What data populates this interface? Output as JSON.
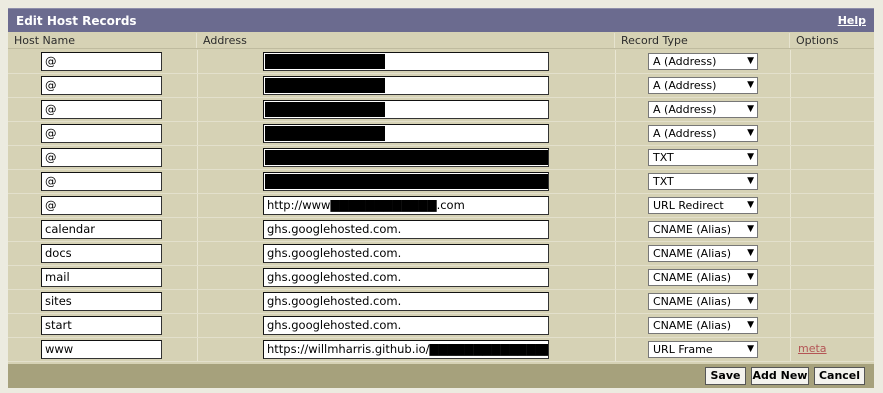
{
  "title": "Edit Host Records",
  "help_label": "Help",
  "columns": [
    "Host Name",
    "Address",
    "Record Type",
    "Options"
  ],
  "records": [
    {
      "host": "@",
      "addr": "",
      "redact": 120,
      "type": "A (Address)",
      "option": ""
    },
    {
      "host": "@",
      "addr": "",
      "redact": 120,
      "type": "A (Address)",
      "option": ""
    },
    {
      "host": "@",
      "addr": "",
      "redact": 120,
      "type": "A (Address)",
      "option": ""
    },
    {
      "host": "@",
      "addr": "",
      "redact": 120,
      "type": "A (Address)",
      "option": ""
    },
    {
      "host": "@",
      "addr": "",
      "redact": 284,
      "type": "TXT",
      "option": ""
    },
    {
      "host": "@",
      "addr": "",
      "redact": 284,
      "type": "TXT",
      "option": ""
    },
    {
      "host": "@",
      "addr": "http://www▇▇▇▇▇▇▇▇▇▇▇▇.com",
      "redact": 0,
      "type": "URL Redirect",
      "option": ""
    },
    {
      "host": "calendar",
      "addr": "ghs.googlehosted.com.",
      "redact": 0,
      "type": "CNAME (Alias)",
      "option": ""
    },
    {
      "host": "docs",
      "addr": "ghs.googlehosted.com.",
      "redact": 0,
      "type": "CNAME (Alias)",
      "option": ""
    },
    {
      "host": "mail",
      "addr": "ghs.googlehosted.com.",
      "redact": 0,
      "type": "CNAME (Alias)",
      "option": ""
    },
    {
      "host": "sites",
      "addr": "ghs.googlehosted.com.",
      "redact": 0,
      "type": "CNAME (Alias)",
      "option": ""
    },
    {
      "host": "start",
      "addr": "ghs.googlehosted.com.",
      "redact": 0,
      "type": "CNAME (Alias)",
      "option": ""
    },
    {
      "host": "www",
      "addr": "https://willmharris.github.io/▇▇▇▇▇▇▇▇▇▇▇▇▇▇",
      "redact": 0,
      "type": "URL Frame",
      "option": "meta"
    }
  ],
  "buttons": {
    "save": "Save",
    "add_new": "Add New",
    "cancel": "Cancel"
  },
  "colors": {
    "titlebar": "#6b6b8f",
    "panel": "#d6d2b5",
    "footer": "#a6a17c",
    "link": "#b45555"
  }
}
